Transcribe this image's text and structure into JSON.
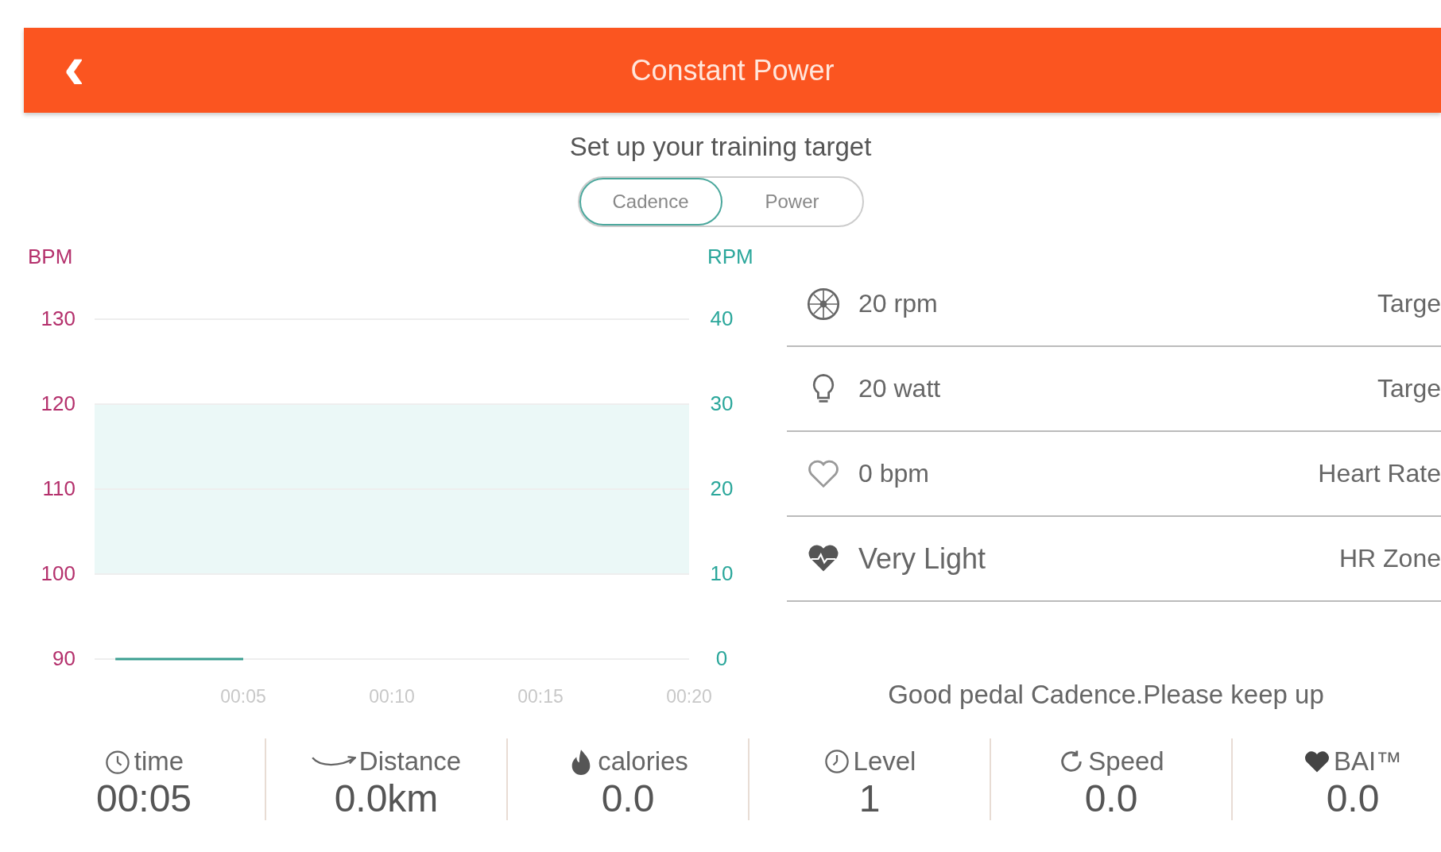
{
  "header": {
    "back_icon": "‹",
    "title": "Constant Power"
  },
  "subtitle": "Set up your training target",
  "toggle": [
    {
      "label": "Cadence",
      "selected": true
    },
    {
      "label": "Power",
      "selected": false
    }
  ],
  "chart": {
    "chart_data": {
      "type": "line",
      "ylabel": "RPM",
      "y2label": "BPM",
      "xticks": [
        {
          "value": 5,
          "label": "00:05"
        },
        {
          "value": 10,
          "label": "00:10"
        },
        {
          "value": 15,
          "label": "00:15"
        },
        {
          "value": 20,
          "label": "00:20"
        }
      ],
      "yticks": [
        0,
        10,
        20,
        30,
        40
      ],
      "y2ticks": [
        90,
        100,
        110,
        120,
        130
      ],
      "xlim": [
        0,
        20
      ],
      "ylim": [
        0,
        40
      ],
      "y2lim": [
        90,
        130
      ],
      "grid": true,
      "series": [
        {
          "color": "#3a9e90",
          "x": [
            0.7,
            5
          ],
          "values": [
            0,
            0
          ]
        }
      ],
      "bands": [
        {
          "axis": "y",
          "from": 10,
          "to": 30
        }
      ]
    }
  },
  "metrics": [
    {
      "kind": "cadence",
      "value": "20 rpm",
      "label": "Targe"
    },
    {
      "kind": "power",
      "value": "20 watt",
      "label": "Targe"
    },
    {
      "kind": "heart",
      "value": "0 bpm",
      "label": "Heart Rate"
    },
    {
      "kind": "zone",
      "value": "Very Light",
      "label": "HR Zone"
    }
  ],
  "message": "Good pedal Cadence.Please keep up",
  "stats": [
    {
      "kind": "time",
      "label": "time",
      "value": "00:05"
    },
    {
      "kind": "distance",
      "label": "Distance",
      "value": "0.0km"
    },
    {
      "kind": "calories",
      "label": "calories",
      "value": "0.0"
    },
    {
      "kind": "level",
      "label": "Level",
      "value": "1"
    },
    {
      "kind": "speed",
      "label": "Speed",
      "value": "0.0"
    },
    {
      "kind": "bai",
      "label": "BAI™",
      "value": "0.0"
    }
  ]
}
